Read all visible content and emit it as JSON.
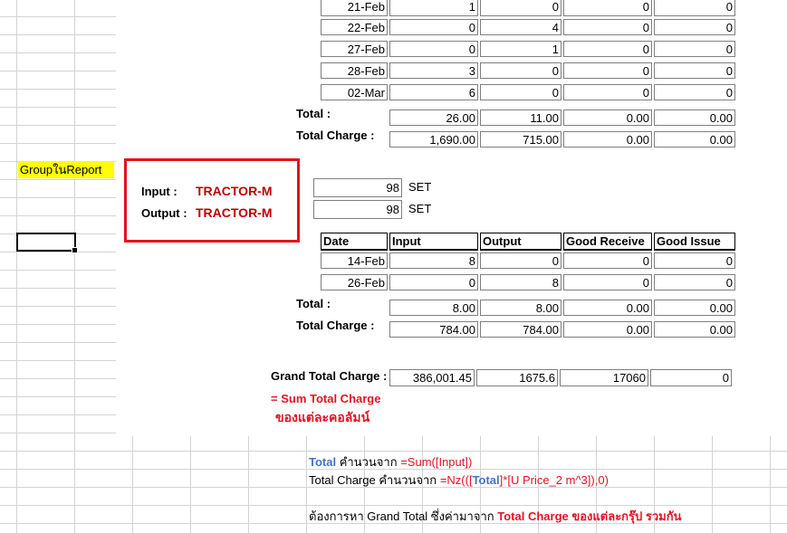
{
  "group_tag": "GroupในReport",
  "group1": {
    "rows": [
      {
        "date": "21-Feb",
        "input": "1",
        "output": "0",
        "good_receive": "0",
        "good_issue": "0"
      },
      {
        "date": "22-Feb",
        "input": "0",
        "output": "4",
        "good_receive": "0",
        "good_issue": "0"
      },
      {
        "date": "27-Feb",
        "input": "0",
        "output": "1",
        "good_receive": "0",
        "good_issue": "0"
      },
      {
        "date": "28-Feb",
        "input": "3",
        "output": "0",
        "good_receive": "0",
        "good_issue": "0"
      },
      {
        "date": "02-Mar",
        "input": "6",
        "output": "0",
        "good_receive": "0",
        "good_issue": "0"
      }
    ],
    "total_label": "Total :",
    "total": [
      "26.00",
      "11.00",
      "0.00",
      "0.00"
    ],
    "total_charge_label": "Total Charge :",
    "total_charge": [
      "1,690.00",
      "715.00",
      "0.00",
      "0.00"
    ]
  },
  "group2": {
    "input_label": "Input :",
    "input_value": "TRACTOR-M",
    "output_label": "Output :",
    "output_value": "TRACTOR-M",
    "input_qty": "98",
    "input_unit": "SET",
    "output_qty": "98",
    "output_unit": "SET",
    "headers": [
      "Date",
      "Input",
      "Output",
      "Good Receive",
      "Good Issue"
    ],
    "rows": [
      {
        "date": "14-Feb",
        "input": "8",
        "output": "0",
        "good_receive": "0",
        "good_issue": "0"
      },
      {
        "date": "26-Feb",
        "input": "0",
        "output": "8",
        "good_receive": "0",
        "good_issue": "0"
      }
    ],
    "total_label": "Total :",
    "total": [
      "8.00",
      "8.00",
      "0.00",
      "0.00"
    ],
    "total_charge_label": "Total Charge :",
    "total_charge": [
      "784.00",
      "784.00",
      "0.00",
      "0.00"
    ]
  },
  "grand_total": {
    "label": "Grand Total Charge :",
    "values": [
      "386,001.45",
      "1675.6",
      "17060",
      "0"
    ],
    "note_line1": "= Sum Total Charge",
    "note_line2": "ของแต่ละคอลัมน์"
  },
  "notes": {
    "line1_keyword": "Total",
    "line1_text": "คำนวนจาก",
    "line1_formula": "=Sum([Input])",
    "line2_text": "Total Charge คำนวนจาก",
    "line2_formula_a": "=Nz(([",
    "line2_formula_total": "Total",
    "line2_formula_b": "]*[U Price_2 m^3]),0)",
    "line3_text": "ต้องการหา Grand Total ซึ่งค่ามาจาก",
    "line3_highlight": "Total Charge ของแต่ละกรุ๊ป รวมกัน"
  },
  "colors": {
    "accent_red": "#c00000",
    "bright_red": "#e81123",
    "blue": "#4472c4",
    "highlight": "#ffff00"
  }
}
